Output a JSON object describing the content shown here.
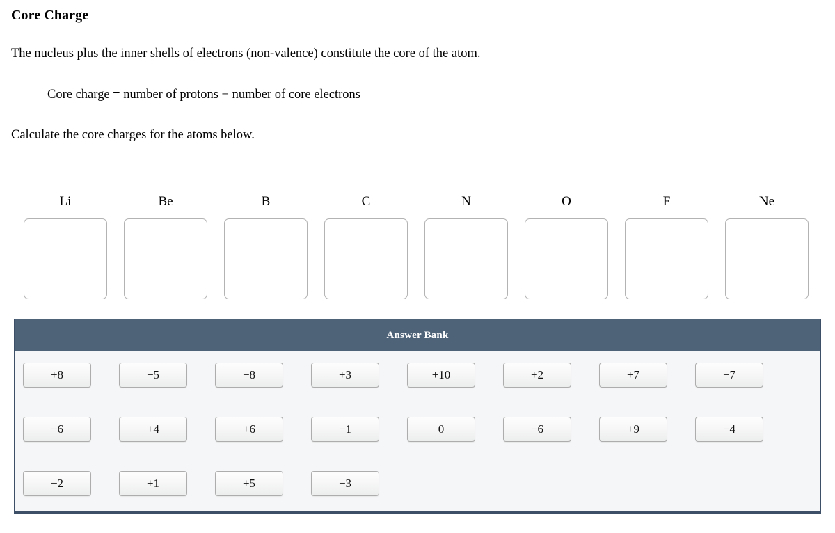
{
  "title": "Core Charge",
  "intro": "The nucleus plus the inner shells of electrons (non-valence) constitute the core of the atom.",
  "formula": "Core charge = number of protons − number of core electrons",
  "instruction": "Calculate the core charges for the atoms below.",
  "elements": [
    {
      "symbol": "Li",
      "value": ""
    },
    {
      "symbol": "Be",
      "value": ""
    },
    {
      "symbol": "B",
      "value": ""
    },
    {
      "symbol": "C",
      "value": ""
    },
    {
      "symbol": "N",
      "value": ""
    },
    {
      "symbol": "O",
      "value": ""
    },
    {
      "symbol": "F",
      "value": ""
    },
    {
      "symbol": "Ne",
      "value": ""
    }
  ],
  "answer_bank": {
    "header": "Answer Bank",
    "header_color": "#4e6278",
    "border_color": "#3d4f66",
    "body_color": "#f5f6f7",
    "rows": [
      [
        "+8",
        "−5",
        "−8",
        "+3",
        "+10",
        "+2",
        "+7",
        "−7"
      ],
      [
        "−6",
        "+4",
        "+6",
        "−1",
        "0",
        "−6",
        "+9",
        "−4"
      ],
      [
        "−2",
        "+1",
        "+5",
        "−3"
      ]
    ]
  }
}
